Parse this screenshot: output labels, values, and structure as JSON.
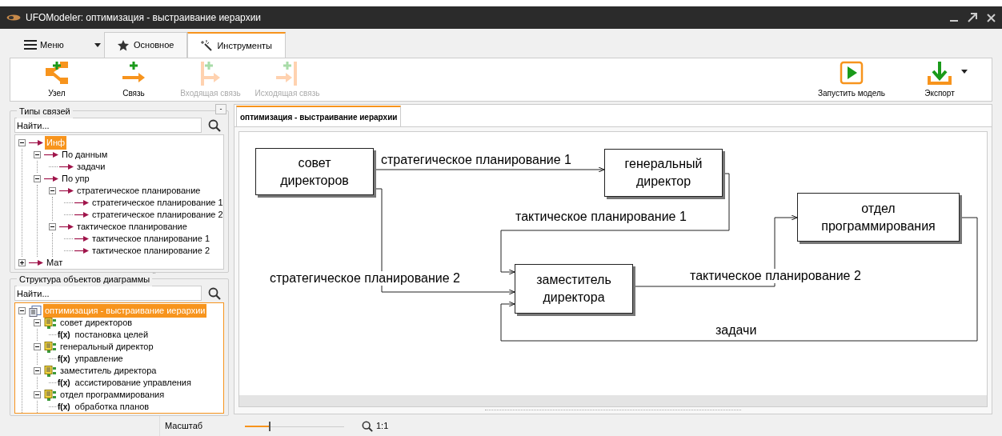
{
  "window": {
    "title": "UFOModeler: оптимизация - выстраивание иерархии"
  },
  "menu_button": {
    "label": "Меню"
  },
  "tabs": [
    {
      "label": "Основное",
      "selected": false
    },
    {
      "label": "Инструменты",
      "selected": true
    }
  ],
  "toolbar": {
    "left": [
      {
        "label": "Узел",
        "kind": "node",
        "disabled": false
      },
      {
        "label": "Связь",
        "kind": "link",
        "disabled": false
      },
      {
        "label": "Входящая связь",
        "kind": "incoming",
        "disabled": true
      },
      {
        "label": "Исходящая связь",
        "kind": "outgoing",
        "disabled": true
      }
    ],
    "right": [
      {
        "label": "Запустить модель",
        "kind": "run",
        "dropdown": false
      },
      {
        "label": "Экспорт",
        "kind": "export",
        "dropdown": true
      }
    ]
  },
  "link_types": {
    "title": "Типы связей",
    "collapse_button": "-",
    "search": {
      "placeholder": "Найти..."
    },
    "tree": [
      {
        "label": "Инф",
        "selected": true,
        "expanded": true,
        "children": [
          {
            "label": "По данным",
            "selected": false,
            "expanded": true,
            "children": [
              {
                "label": "задачи",
                "selected": false
              }
            ]
          },
          {
            "label": "По упр",
            "selected": false,
            "expanded": true,
            "children": [
              {
                "label": "стратегическое планирование",
                "selected": false,
                "expanded": true,
                "children": [
                  {
                    "label": "стратегическое планирование 1",
                    "selected": false
                  },
                  {
                    "label": "стратегическое планирование 2",
                    "selected": false
                  }
                ]
              },
              {
                "label": "тактическое планирование",
                "selected": false,
                "expanded": true,
                "children": [
                  {
                    "label": "тактическое планирование 1",
                    "selected": false
                  },
                  {
                    "label": "тактическое планирование 2",
                    "selected": false
                  }
                ]
              }
            ]
          }
        ]
      },
      {
        "label": "Мат",
        "selected": false,
        "expanded": false
      }
    ]
  },
  "objects": {
    "title": "Структура объектов диаграммы",
    "search": {
      "placeholder": "Найти..."
    },
    "tree": [
      {
        "label": "оптимизация - выстраивание иерархии",
        "kind": "diagram",
        "selected": true,
        "expanded": true,
        "children": [
          {
            "label": "совет директоров",
            "kind": "object",
            "selected": false,
            "expanded": true,
            "children": [
              {
                "label": "постановка целей",
                "kind": "function",
                "prefix": "f(x)",
                "selected": false
              }
            ]
          },
          {
            "label": "генеральный директор",
            "kind": "object",
            "selected": false,
            "expanded": true,
            "children": [
              {
                "label": "управление",
                "kind": "function",
                "prefix": "f(x)",
                "selected": false
              }
            ]
          },
          {
            "label": "заместитель директора",
            "kind": "object",
            "selected": false,
            "expanded": true,
            "children": [
              {
                "label": "ассистирование управления",
                "kind": "function",
                "prefix": "f(x)",
                "selected": false
              }
            ]
          },
          {
            "label": "отдел программирования",
            "kind": "object",
            "selected": false,
            "expanded": true,
            "children": [
              {
                "label": "обработка планов",
                "kind": "function",
                "prefix": "f(x)",
                "selected": false
              }
            ]
          }
        ]
      }
    ]
  },
  "document_tab": {
    "label": "оптимизация - выстраивание иерархии",
    "selected": true
  },
  "diagram": {
    "nodes": [
      {
        "label": "совет директоров"
      },
      {
        "label": "генеральный директор"
      },
      {
        "label": "отдел программирования"
      },
      {
        "label": "заместитель директора"
      }
    ],
    "links": [
      {
        "label": "стратегическое планирование 1"
      },
      {
        "label": "тактическое планирование 1"
      },
      {
        "label": "стратегическое планирование 2"
      },
      {
        "label": "тактическое планирование 2"
      },
      {
        "label": "задачи"
      }
    ]
  },
  "status_bar": {
    "zoom_label": "Масштаб",
    "zoom": {
      "level": 0.24
    },
    "zoom_reading": "1:1"
  }
}
